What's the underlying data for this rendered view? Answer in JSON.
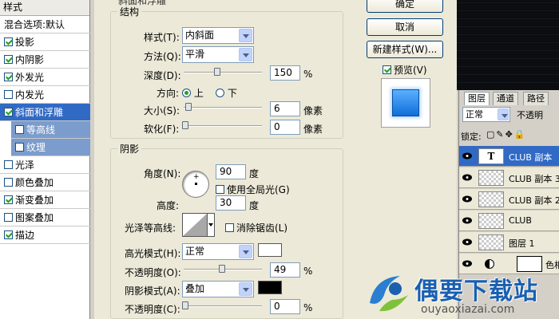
{
  "styles_panel": {
    "title": "样式",
    "blend_options": "混合选项:默认",
    "items": [
      {
        "label": "投影",
        "checked": true
      },
      {
        "label": "内阴影",
        "checked": true
      },
      {
        "label": "外发光",
        "checked": true
      },
      {
        "label": "内发光",
        "checked": false
      },
      {
        "label": "斜面和浮雕",
        "checked": true,
        "selected": true
      },
      {
        "label": "等高线",
        "checked": false,
        "sub": true
      },
      {
        "label": "纹理",
        "checked": false,
        "sub": true
      },
      {
        "label": "光泽",
        "checked": false
      },
      {
        "label": "颜色叠加",
        "checked": false
      },
      {
        "label": "渐变叠加",
        "checked": true
      },
      {
        "label": "图案叠加",
        "checked": false
      },
      {
        "label": "描边",
        "checked": true
      }
    ]
  },
  "bevel": {
    "section_title": "斜面和浮雕",
    "structure": {
      "legend": "结构",
      "style_label": "样式(T):",
      "style_value": "内斜面",
      "technique_label": "方法(Q):",
      "technique_value": "平滑",
      "depth_label": "深度(D):",
      "depth_value": "150",
      "depth_unit": "%",
      "direction_label": "方向:",
      "direction_up": "上",
      "direction_down": "下",
      "size_label": "大小(S):",
      "size_value": "6",
      "size_unit": "像素",
      "soften_label": "软化(F):",
      "soften_value": "0",
      "soften_unit": "像素"
    },
    "shading": {
      "legend": "阴影",
      "angle_label": "角度(N):",
      "angle_value": "90",
      "angle_unit": "度",
      "global_light_label": "使用全局光(G)",
      "altitude_label": "高度:",
      "altitude_value": "30",
      "altitude_unit": "度",
      "gloss_label": "光泽等高线:",
      "antialias_label": "消除锯齿(L)",
      "highlight_mode_label": "高光模式(H):",
      "highlight_mode_value": "正常",
      "highlight_color": "#ffffff",
      "highlight_opacity_label": "不透明度(O):",
      "highlight_opacity_value": "49",
      "highlight_opacity_unit": "%",
      "shadow_mode_label": "阴影模式(A):",
      "shadow_mode_value": "叠加",
      "shadow_color": "#000000",
      "shadow_opacity_label": "不透明度(C):",
      "shadow_opacity_value": "0",
      "shadow_opacity_unit": "%"
    }
  },
  "buttons": {
    "ok": "确定",
    "cancel": "取消",
    "new_style": "新建样式(W)...",
    "preview": "预览(V)"
  },
  "layers_panel": {
    "tabs": [
      "图层",
      "通道",
      "路径"
    ],
    "blend_mode": "正常",
    "opacity_label": "不透明",
    "lock_label": "锁定:",
    "layers": [
      {
        "name": "CLUB 副本",
        "type": "text",
        "selected": true
      },
      {
        "name": "CLUB 副本 3",
        "type": "pixel"
      },
      {
        "name": "CLUB 副本 2",
        "type": "pixel"
      },
      {
        "name": "CLUB",
        "type": "pixel"
      },
      {
        "name": "图层 1",
        "type": "pixel"
      },
      {
        "name": "色相",
        "type": "adjust"
      }
    ]
  },
  "watermark": {
    "title": "偶要下载站",
    "url": "ouyaoxiazai.com"
  },
  "colors": {
    "selection": "#316ac5",
    "preview_blue": "#1e7fe6"
  }
}
